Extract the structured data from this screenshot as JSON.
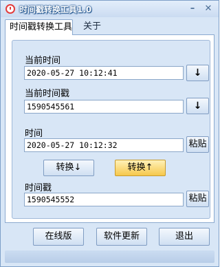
{
  "window": {
    "title": "时间戳转换工具1.0",
    "minimize_symbol": "–",
    "close_symbol": "✕"
  },
  "tabs": [
    {
      "label": "时间戳转换工具",
      "active": true
    },
    {
      "label": "关于",
      "active": false
    }
  ],
  "current": {
    "time_label": "当前时间",
    "time_value": "2020-05-27 10:12:41",
    "timestamp_label": "当前时间戳",
    "timestamp_value": "1590545561",
    "down_symbol": "↓"
  },
  "convert": {
    "time_label": "时间",
    "time_value": "2020-05-27 10:12:32",
    "paste_label": "粘贴",
    "to_timestamp_label": "转换↓",
    "to_time_label": "转换↑",
    "timestamp_label": "时间戳",
    "timestamp_value": "1590545552"
  },
  "footer": {
    "online_label": "在线版",
    "update_label": "软件更新",
    "exit_label": "退出"
  },
  "colors": {
    "window_bg": "#d8e6f6",
    "highlight_button": "#f6c84c",
    "title_text": "#ffffff"
  },
  "icons": [
    "app-icon",
    "minimize-icon",
    "close-icon",
    "arrow-down-icon"
  ]
}
